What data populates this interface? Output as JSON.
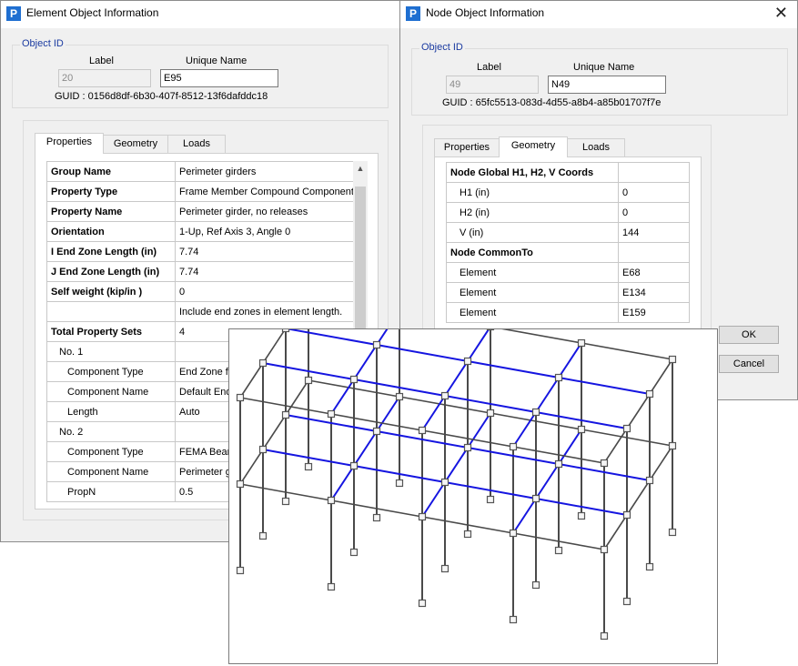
{
  "element_window": {
    "title": "Element Object Information",
    "object_id_label": "Object ID",
    "label_header": "Label",
    "unique_name_header": "Unique Name",
    "label_value": "20",
    "unique_name_value": "E95",
    "guid": "GUID : 0156d8df-6b30-407f-8512-13f6dafddc18",
    "tabs": [
      "Properties",
      "Geometry",
      "Loads"
    ],
    "active_tab": "Properties",
    "rows": [
      {
        "k": "Group Name",
        "v": "Perimeter girders",
        "bold": true,
        "indent": 0
      },
      {
        "k": "Property Type",
        "v": "Frame Member Compound Component",
        "bold": true,
        "indent": 0
      },
      {
        "k": "Property Name",
        "v": "Perimeter girder, no releases",
        "bold": true,
        "indent": 0
      },
      {
        "k": "Orientation",
        "v": "1-Up, Ref Axis 3, Angle 0",
        "bold": true,
        "indent": 0
      },
      {
        "k": "I End Zone Length (in)",
        "v": "7.74",
        "bold": true,
        "indent": 0
      },
      {
        "k": "J End Zone Length (in)",
        "v": "7.74",
        "bold": true,
        "indent": 0
      },
      {
        "k": "Self weight (kip/in )",
        "v": "0",
        "bold": true,
        "indent": 0
      },
      {
        "k": "",
        "v": "Include end zones in element length.",
        "bold": false,
        "indent": 0
      },
      {
        "k": "Total Property Sets",
        "v": "4",
        "bold": true,
        "indent": 0
      },
      {
        "k": "No. 1",
        "v": "",
        "bold": false,
        "indent": 1
      },
      {
        "k": "Component Type",
        "v": "End Zone fo",
        "bold": false,
        "indent": 2
      },
      {
        "k": "Component Name",
        "v": "Default End",
        "bold": false,
        "indent": 2
      },
      {
        "k": "Length",
        "v": "Auto",
        "bold": false,
        "indent": 2
      },
      {
        "k": "No. 2",
        "v": "",
        "bold": false,
        "indent": 1
      },
      {
        "k": "Component Type",
        "v": "FEMA Beam",
        "bold": false,
        "indent": 2
      },
      {
        "k": "Component Name",
        "v": "Perimeter gir",
        "bold": false,
        "indent": 2
      },
      {
        "k": "PropN",
        "v": "0.5",
        "bold": false,
        "indent": 2
      }
    ]
  },
  "node_window": {
    "title": "Node Object Information",
    "object_id_label": "Object ID",
    "label_header": "Label",
    "unique_name_header": "Unique Name",
    "label_value": "49",
    "unique_name_value": "N49",
    "guid": "GUID : 65fc5513-083d-4d55-a8b4-a85b01707f7e",
    "tabs": [
      "Properties",
      "Geometry",
      "Loads"
    ],
    "active_tab": "Geometry",
    "rows": [
      {
        "k": "Node Global H1, H2, V Coords",
        "v": "",
        "bold": true,
        "indent": 0
      },
      {
        "k": "H1 (in)",
        "v": "0",
        "bold": false,
        "indent": 1
      },
      {
        "k": "H2 (in)",
        "v": "0",
        "bold": false,
        "indent": 1
      },
      {
        "k": "V (in)",
        "v": "144",
        "bold": false,
        "indent": 1
      },
      {
        "k": "Node CommonTo",
        "v": "",
        "bold": true,
        "indent": 0
      },
      {
        "k": "Element",
        "v": "E68",
        "bold": false,
        "indent": 1
      },
      {
        "k": "Element",
        "v": "E134",
        "bold": false,
        "indent": 1
      },
      {
        "k": "Element",
        "v": "E159",
        "bold": false,
        "indent": 1
      }
    ],
    "ok_label": "OK",
    "cancel_label": "Cancel"
  },
  "viewer": {
    "colors": {
      "frame": "#4a4a4a",
      "highlight": "#1515e0",
      "node": "#555555"
    }
  }
}
